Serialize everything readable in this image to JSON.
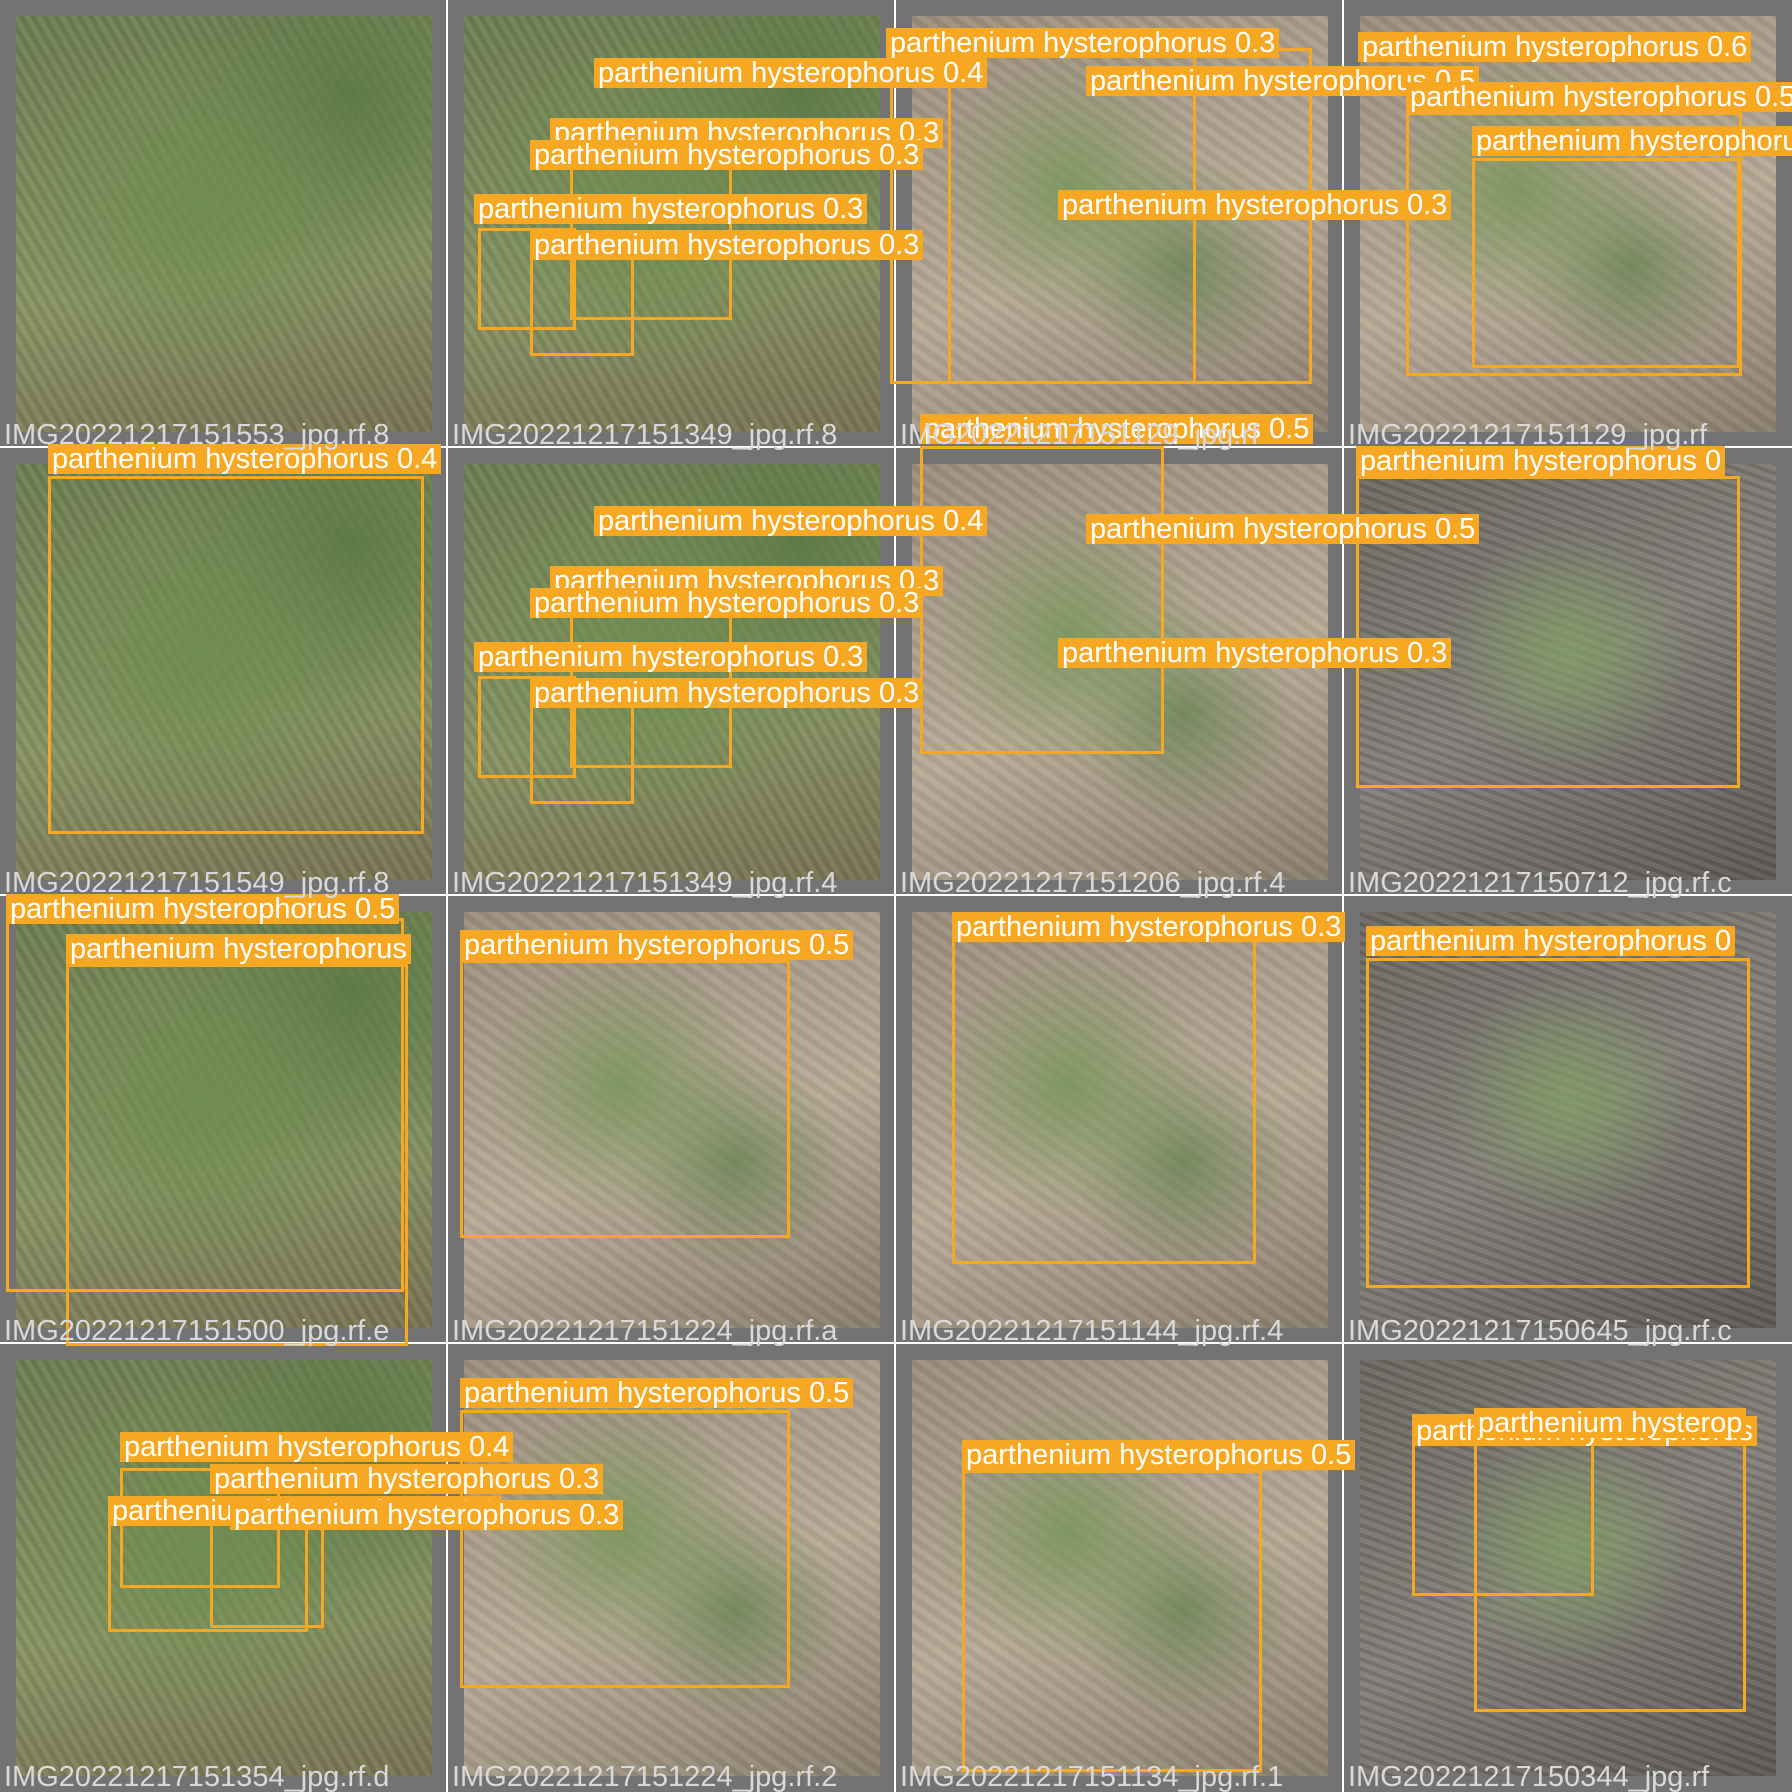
{
  "colors": {
    "box": "#f7a823",
    "label_text": "#ffffff",
    "filename_text": "#d9d9d9",
    "background": "#737373"
  },
  "icons": [
    "plant-photo-image"
  ],
  "tiles": [
    {
      "filename": "IMG20221217151553_jpg.rf.8",
      "labels": []
    },
    {
      "filename": "IMG20221217151349_jpg.rf.8",
      "labels": [
        "parthenium hysterophorus 0.4",
        "parthenium hysterophorus 0.3",
        "parthenium hysterophorus 0.3",
        "parthenium hysterophorus 0.3",
        "parthenium hysterophorus 0.3",
        "parthenium hysterophorus 0.5",
        "parthenium hysterophorus 0.3"
      ]
    },
    {
      "filename": "IMG20221217151129_jpg.rf",
      "labels": [
        "parthenium hysterophorus 0.3",
        "parthenium hysterophorus 0.5"
      ]
    },
    {
      "filename": "IMG20221217151129_jpg.rf",
      "labels": [
        "parthenium hysterophorus 0.6",
        "parthenium hysterophorus 0.5"
      ]
    },
    {
      "filename": "IMG20221217151549_jpg.rf.8",
      "labels": [
        "parthenium hysterophorus 0.4"
      ]
    },
    {
      "filename": "IMG20221217151349_jpg.rf.4",
      "labels": [
        "parthenium hysterophorus 0.4",
        "parthenium hysterophorus 0.3",
        "parthenium hysterophorus 0.3",
        "parthenium hysterophorus 0.3",
        "parthenium hysterophorus 0.3",
        "parthenium hysterophorus 0.5",
        "parthenium hysterophorus 0.3"
      ]
    },
    {
      "filename": "IMG20221217151206_jpg.rf.4",
      "labels": [
        "parthenium hysterophorus 0.5"
      ]
    },
    {
      "filename": "IMG20221217150712_jpg.rf.c",
      "labels": [
        "parthenium hysterophorus 0"
      ]
    },
    {
      "filename": "IMG20221217151500_jpg.rf.e",
      "labels": [
        "parthenium hysterophorus 0.5",
        "parthenium hysterophorus"
      ]
    },
    {
      "filename": "IMG20221217151224_jpg.rf.a",
      "labels": [
        "parthenium hysterophorus 0.5"
      ]
    },
    {
      "filename": "IMG20221217151144_jpg.rf.4",
      "labels": [
        "parthenium hysterophorus 0.3"
      ]
    },
    {
      "filename": "IMG20221217150645_jpg.rf.c",
      "labels": [
        "parthenium hysterophorus 0"
      ]
    },
    {
      "filename": "IMG20221217151354_jpg.rf.d",
      "labels": [
        "parthenium hysterophorus 0.4",
        "parthenium hysterophorus 0.3",
        "parthenium hysterophorus 0.3",
        "parthenium hysterophorus 0.3"
      ]
    },
    {
      "filename": "IMG20221217151224_jpg.rf.2",
      "labels": [
        "parthenium hysterophorus 0.5"
      ]
    },
    {
      "filename": "IMG20221217151134_jpg.rf.1",
      "labels": [
        "parthenium hysterophorus 0.5"
      ]
    },
    {
      "filename": "IMG20221217150344_jpg.rf",
      "labels": [
        "parthenium hysterophorus",
        "parthenium hysterop"
      ]
    }
  ]
}
